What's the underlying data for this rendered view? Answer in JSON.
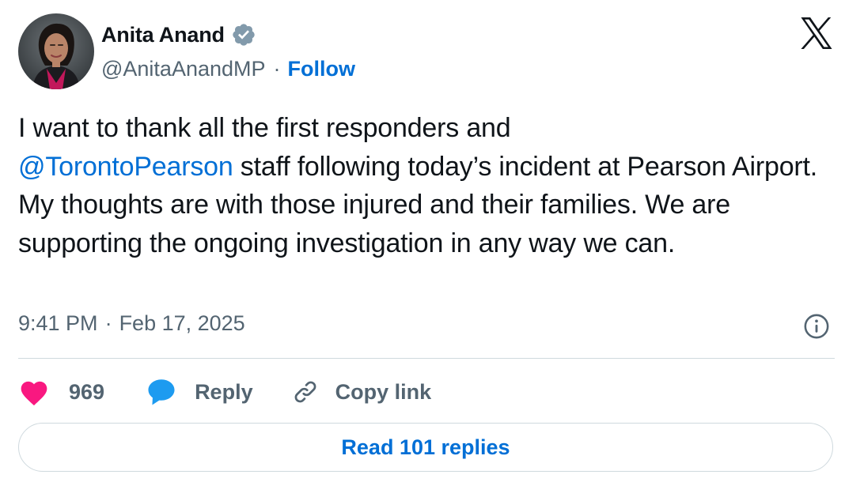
{
  "author": {
    "name": "Anita Anand",
    "handle": "@AnitaAnandMP",
    "separator": "·",
    "follow_label": "Follow",
    "verified": true,
    "verified_color": "#829aab"
  },
  "brand": {
    "logo": "x-logo-icon",
    "color": "#0f1419"
  },
  "tweet": {
    "text_before": "I want to thank all the first responders and",
    "mention": "@TorontoPearson",
    "text_after": " staff following today’s incident at Pearson Airport. My thoughts are with those injured and their families. We are supporting the ongoing investigation in any way we can."
  },
  "meta": {
    "time": "9:41 PM",
    "separator": "·",
    "date": "Feb 17, 2025",
    "info_icon": "info-icon"
  },
  "actions": {
    "likes_count": "969",
    "like_icon": "heart-icon",
    "like_color": "#f91880",
    "reply_label": "Reply",
    "reply_icon": "reply-bubble-icon",
    "reply_color": "#1d9bf0",
    "copy_label": "Copy link",
    "copy_icon": "link-icon"
  },
  "footer": {
    "read_replies_label": "Read 101 replies"
  },
  "colors": {
    "link": "#006fd6",
    "secondary_text": "#536471",
    "divider": "#cfd9de"
  }
}
